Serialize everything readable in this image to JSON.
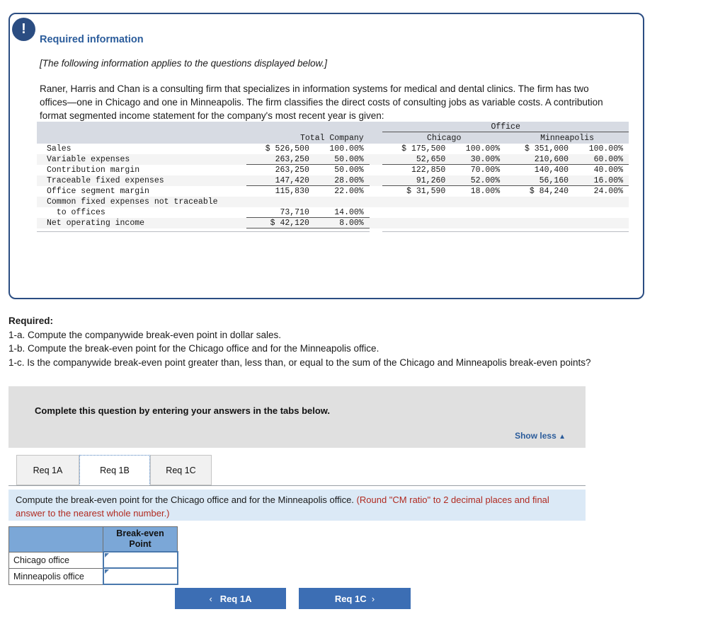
{
  "panel": {
    "alert_icon": "exclamation-icon",
    "title": "Required information",
    "note": "[The following information applies to the questions displayed below.]",
    "paragraph": "Raner, Harris and Chan is a consulting firm that specializes in information systems for medical and dental clinics. The firm has two offices—one in Chicago and one in Minneapolis. The firm classifies the direct costs of consulting jobs as variable costs. A contribution format segmented income statement for the company's most recent year is given:"
  },
  "statement": {
    "group_header": "Office",
    "col_total": "Total Company",
    "col_chicago": "Chicago",
    "col_minneapolis": "Minneapolis",
    "rows": [
      {
        "label": "Sales",
        "total": "$ 526,500",
        "total_pct": "100.00%",
        "chicago": "$ 175,500",
        "chicago_pct": "100.00%",
        "minneapolis": "$ 351,000",
        "minneapolis_pct": "100.00%"
      },
      {
        "label": "Variable expenses",
        "total": "263,250",
        "total_pct": "50.00%",
        "chicago": "52,650",
        "chicago_pct": "30.00%",
        "minneapolis": "210,600",
        "minneapolis_pct": "60.00%"
      },
      {
        "label": "Contribution margin",
        "total": "263,250",
        "total_pct": "50.00%",
        "chicago": "122,850",
        "chicago_pct": "70.00%",
        "minneapolis": "140,400",
        "minneapolis_pct": "40.00%"
      },
      {
        "label": "Traceable fixed expenses",
        "total": "147,420",
        "total_pct": "28.00%",
        "chicago": "91,260",
        "chicago_pct": "52.00%",
        "minneapolis": "56,160",
        "minneapolis_pct": "16.00%"
      },
      {
        "label": "Office segment margin",
        "total": "115,830",
        "total_pct": "22.00%",
        "chicago": "$ 31,590",
        "chicago_pct": "18.00%",
        "minneapolis": "$ 84,240",
        "minneapolis_pct": "24.00%"
      },
      {
        "label": "Common fixed expenses not traceable",
        "total": "",
        "total_pct": "",
        "chicago": "",
        "chicago_pct": "",
        "minneapolis": "",
        "minneapolis_pct": ""
      },
      {
        "label": "  to offices",
        "total": "73,710",
        "total_pct": "14.00%",
        "chicago": "",
        "chicago_pct": "",
        "minneapolis": "",
        "minneapolis_pct": ""
      },
      {
        "label": "Net operating income",
        "total": "$ 42,120",
        "total_pct": "8.00%",
        "chicago": "",
        "chicago_pct": "",
        "minneapolis": "",
        "minneapolis_pct": ""
      }
    ]
  },
  "required": {
    "heading": "Required:",
    "items": [
      "1-a. Compute the companywide break-even point in dollar sales.",
      "1-b. Compute the break-even point for the Chicago office and for the Minneapolis office.",
      "1-c. Is the companywide break-even point greater than, less than, or equal to the sum of the Chicago and Minneapolis break-even points?"
    ]
  },
  "grey_panel": {
    "prompt": "Complete this question by entering your answers in the tabs below.",
    "show_less": "Show less",
    "show_less_caret": "▲"
  },
  "tabs": [
    {
      "label": "Req 1A",
      "active": false
    },
    {
      "label": "Req 1B",
      "active": true
    },
    {
      "label": "Req 1C",
      "active": false
    }
  ],
  "instruction": {
    "text": "Compute the break-even point for the Chicago office and for the Minneapolis office. ",
    "hint": "(Round \"CM ratio\" to 2 decimal places and final answer to the nearest whole number.)"
  },
  "answer_table": {
    "blank_header": "",
    "value_header_line1": "Break-even",
    "value_header_line2": "Point",
    "rows": [
      {
        "label": "Chicago office",
        "value": ""
      },
      {
        "label": "Minneapolis office",
        "value": ""
      }
    ]
  },
  "nav": {
    "prev_chevron": "‹",
    "prev_label": "Req 1A",
    "next_label": "Req 1C",
    "next_chevron": "›"
  },
  "colors": {
    "panel_border": "#2b4d82",
    "accent_blue": "#2b5c9b",
    "button_blue": "#3c6eb4",
    "table_header_blue": "#7ba7d7",
    "instruction_bg": "#dbe9f6",
    "hint_red": "#b02a20",
    "grey_panel_bg": "#e0e0e0"
  }
}
